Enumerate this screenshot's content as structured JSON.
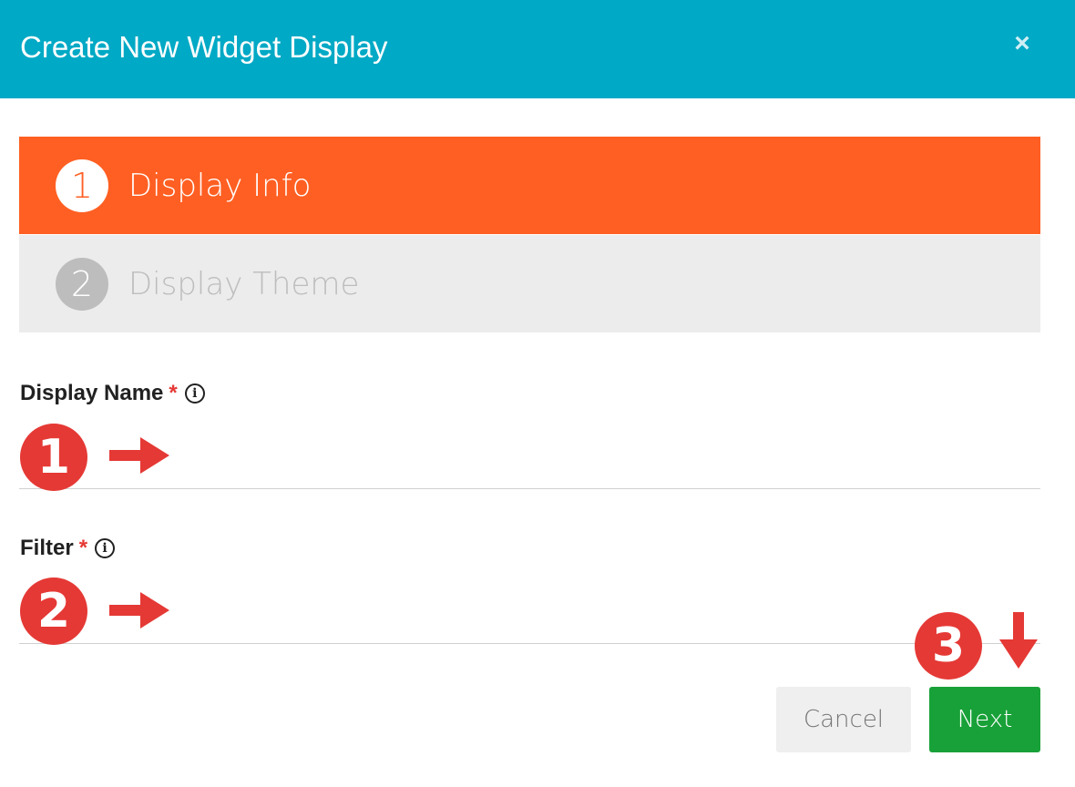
{
  "modal": {
    "title": "Create New Widget Display",
    "close_symbol": "×"
  },
  "steps": [
    {
      "number": "1",
      "label": "Display Info",
      "state": "active"
    },
    {
      "number": "2",
      "label": "Display Theme",
      "state": "inactive"
    }
  ],
  "form": {
    "display_name": {
      "label": "Display Name",
      "required_mark": "*",
      "info_icon": "info-circle-icon",
      "value": ""
    },
    "filter": {
      "label": "Filter",
      "required_mark": "*",
      "info_icon": "info-circle-icon",
      "value": ""
    }
  },
  "annotations": [
    {
      "number": "1",
      "arrow": "right"
    },
    {
      "number": "2",
      "arrow": "right"
    },
    {
      "number": "3",
      "arrow": "down"
    }
  ],
  "buttons": {
    "cancel": "Cancel",
    "next": "Next"
  },
  "colors": {
    "header": "#00a9c5",
    "active_step": "#ff5f22",
    "inactive_step": "#ececec",
    "annotation": "#e53935",
    "next_button": "#18a138"
  }
}
